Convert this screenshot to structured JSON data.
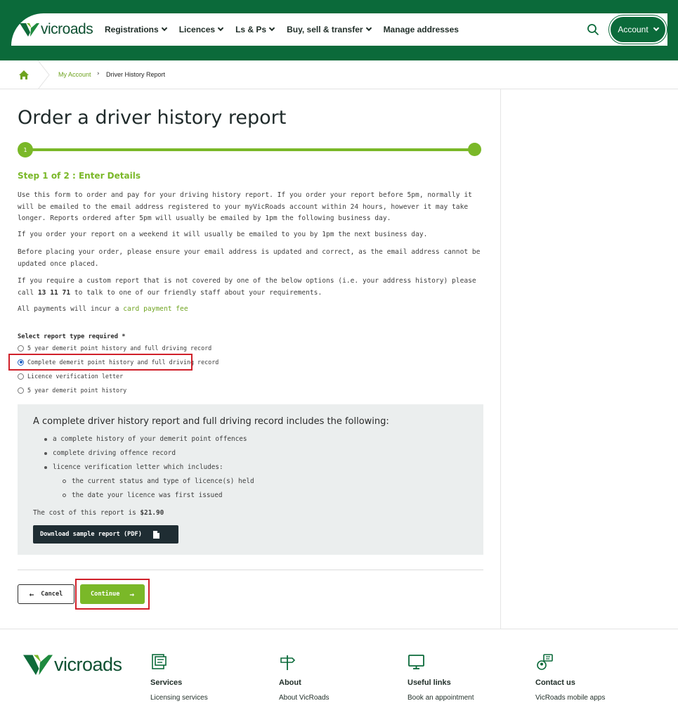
{
  "header": {
    "logo_text": "vicroads",
    "nav": [
      "Registrations",
      "Licences",
      "Ls & Ps",
      "Buy, sell & transfer",
      "Manage addresses"
    ],
    "account_label": "Account"
  },
  "breadcrumb": {
    "parent": "My Account",
    "separator": "›",
    "current": "Driver History Report"
  },
  "page": {
    "title": "Order a driver history report",
    "step_number": "1",
    "step_title": "Step 1 of 2 : Enter Details",
    "intro": "Use this form to order and pay for your driving history report. If you order your report before 5pm, normally it will be emailed to the email address registered to your myVicRoads account within 24 hours, however it may take longer. Reports ordered after 5pm will usually be emailed by 1pm the following business day.",
    "weekend": "If you order your report on a weekend it will usually be emailed to you by 1pm the next business day.",
    "email_note": "Before placing your order, please ensure your email address is updated and correct, as the email address cannot be updated once placed.",
    "custom_before": "If you require a custom report that is not covered by one of the below options (i.e. your address history) please call ",
    "custom_phone": "13 11 71",
    "custom_after": " to talk to one of our friendly staff about your requirements.",
    "payments_before": "All payments will incur a ",
    "payments_link": "card payment fee"
  },
  "report_select": {
    "label": "Select report type required *",
    "options": [
      "5 year demerit point history and full driving record",
      "Complete demerit point history and full driving record",
      "Licence verification letter",
      "5 year demerit point history"
    ],
    "selected_index": 1
  },
  "info_panel": {
    "title": "A complete driver history report and full driving record includes the following:",
    "items": [
      "a complete history of your demerit point offences",
      "complete driving offence record",
      "licence verification letter which includes:"
    ],
    "subitems": [
      "the current status and type of licence(s) held",
      "the date your licence was first issued"
    ],
    "cost_label": "The cost of this report is ",
    "cost_value": "$21.90",
    "download_label": "Download sample report (PDF)"
  },
  "actions": {
    "cancel_label": "Cancel",
    "continue_label": "Continue"
  },
  "footer": {
    "logo_text": "vicroads",
    "columns": [
      {
        "heading": "Services",
        "link": "Licensing services",
        "icon": "services-icon"
      },
      {
        "heading": "About",
        "link": "About VicRoads",
        "icon": "signpost-icon"
      },
      {
        "heading": "Useful links",
        "link": "Book an appointment",
        "icon": "monitor-icon"
      },
      {
        "heading": "Contact us",
        "link": "VicRoads mobile apps",
        "icon": "contact-icon"
      }
    ]
  },
  "colors": {
    "brand_green": "#0b6a3a",
    "accent_green": "#7ab828",
    "highlight_red": "#d0202a"
  }
}
